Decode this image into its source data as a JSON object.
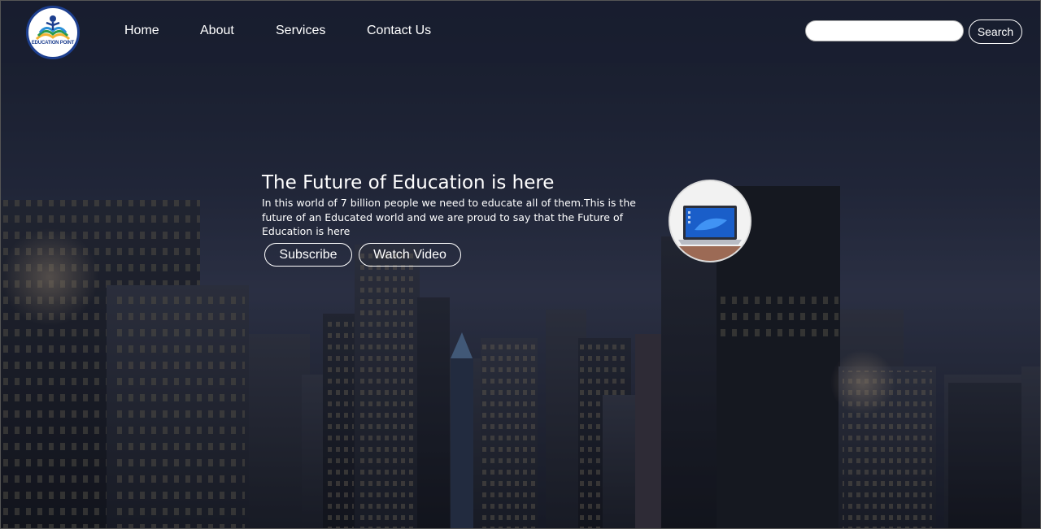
{
  "brand": {
    "logo_text": "EDUCATION POINT"
  },
  "nav": {
    "items": [
      {
        "label": "Home"
      },
      {
        "label": "About"
      },
      {
        "label": "Services"
      },
      {
        "label": "Contact Us"
      }
    ]
  },
  "search": {
    "placeholder": "",
    "value": "",
    "button_label": "Search"
  },
  "hero": {
    "title": "The Future of Education is here",
    "text": "In this world of 7 billion people we need to educate all of them.This is the future of an Educated world and we are proud to say that the Future of Education is here",
    "buttons": [
      {
        "label": "Subscribe"
      },
      {
        "label": "Watch Video"
      }
    ]
  },
  "colors": {
    "brand_blue": "#1d3f8f",
    "nav_background": "#191e30",
    "text": "#ffffff"
  },
  "icons": {
    "logo": "education-point-logo",
    "hero_image": "laptop-image"
  }
}
